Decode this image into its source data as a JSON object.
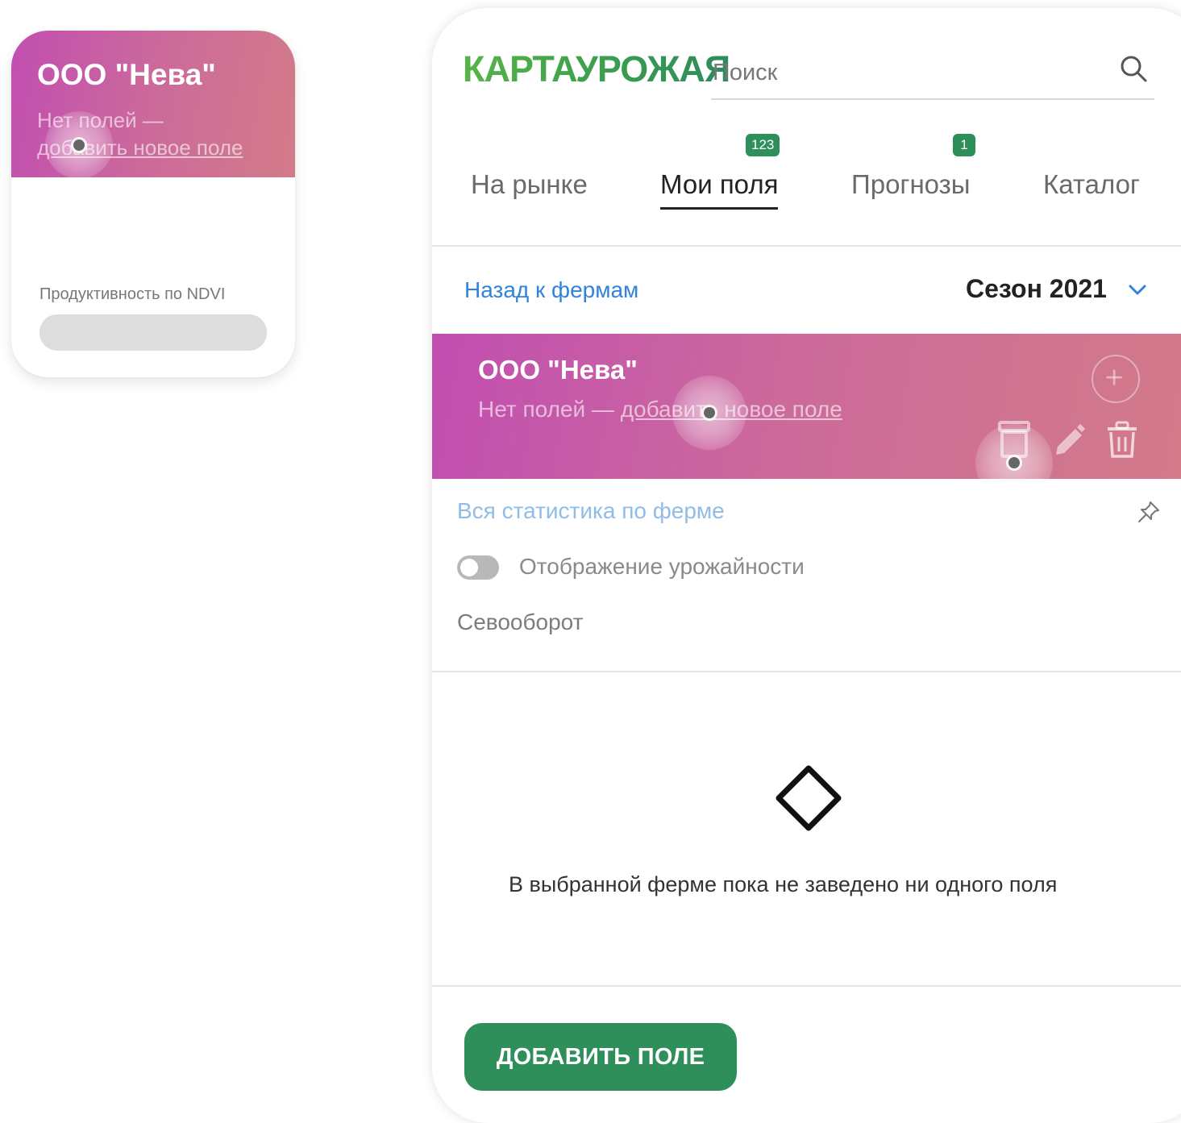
{
  "mini_card": {
    "farm_name": "ООО \"Нева\"",
    "no_fields_text": "Нет полей —",
    "add_field_link": "добавить новое поле",
    "ndvi_label": "Продуктивность по NDVI"
  },
  "header": {
    "logo": "КАРТАУРОЖАЯ",
    "search_placeholder": "Поиск"
  },
  "tabs": [
    {
      "label": "На рынке",
      "badge": null
    },
    {
      "label": "Мои поля",
      "badge": "123"
    },
    {
      "label": "Прогнозы",
      "badge": "1"
    },
    {
      "label": "Каталог",
      "badge": null
    }
  ],
  "subheader": {
    "back_link": "Назад к фермам",
    "season": "Сезон 2021"
  },
  "farm": {
    "name": "ООО \"Нева\"",
    "no_fields_text": "Нет полей — ",
    "add_field_link": "добавить новое поле"
  },
  "panel": {
    "stats_link": "Вся статистика по ферме",
    "yield_toggle_label": "Отображение урожайности",
    "yield_toggle_on": false,
    "crop_rotation_label": "Севооборот"
  },
  "empty_state": {
    "message": "В выбранной ферме пока не заведено ни одного поля"
  },
  "footer": {
    "add_button": "ДОБАВИТЬ ПОЛЕ"
  },
  "colors": {
    "brand_green": "#2f8f5b",
    "link_blue": "#2f84d8",
    "banner_start": "#c14eb1",
    "banner_end": "#d27b88"
  }
}
